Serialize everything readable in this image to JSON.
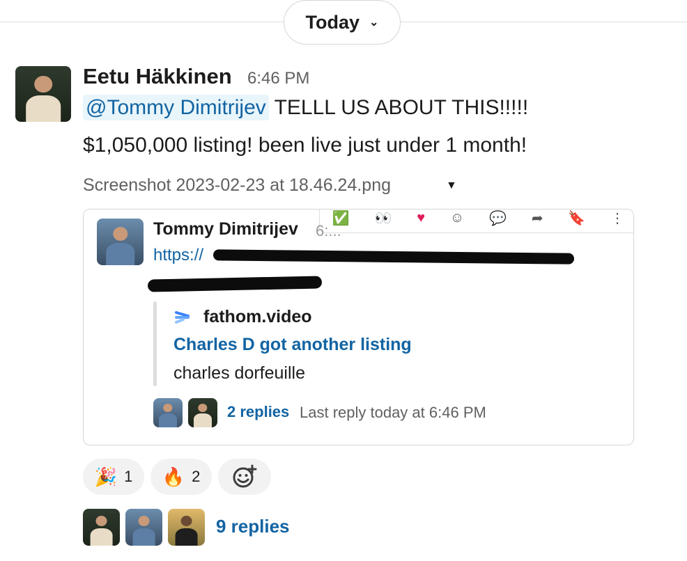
{
  "date_divider": {
    "label": "Today",
    "icon": "chevron-down-icon"
  },
  "message": {
    "sender": "Eetu Häkkinen",
    "time": "6:46 PM",
    "mention": "@Tommy Dimitrijev",
    "text_line1": "TELLL US ABOUT THIS!!!!!",
    "text_line2": "$1,050,000 listing! been live just under 1 month!",
    "attachment_name": "Screenshot 2023-02-23 at 18.46.24.png"
  },
  "attachment": {
    "sender": "Tommy Dimitrijev",
    "time": "6:...",
    "link_prefix": "https://",
    "link_preview": {
      "domain": "fathom.video",
      "title": "Charles D got another listing",
      "description": "charles dorfeuille"
    },
    "replies_count": "2 replies",
    "last_reply": "Last reply today at 6:46 PM"
  },
  "reactions": [
    {
      "emoji": "🎉",
      "count": "1"
    },
    {
      "emoji": "🔥",
      "count": "2"
    }
  ],
  "thread": {
    "replies_count": "9 replies"
  }
}
